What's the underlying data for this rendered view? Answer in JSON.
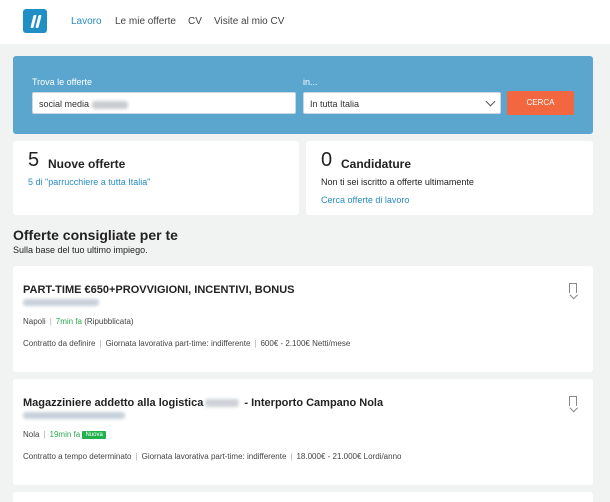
{
  "nav": {
    "items": [
      "Lavoro",
      "Le mie offerte",
      "CV",
      "Visite al mio CV"
    ]
  },
  "search": {
    "what_label": "Trova le offerte",
    "what_value": "social media",
    "where_label": "in...",
    "where_value": "In tutta Italia",
    "button": "CERCA"
  },
  "stats": {
    "new_offers": {
      "count": "5",
      "title": "Nuove offerte",
      "link": "5 di \"parrucchiere a tutta Italia\""
    },
    "applications": {
      "count": "0",
      "title": "Candidature",
      "text": "Non ti sei iscritto a offerte ultimamente",
      "link": "Cerca offerte di lavoro"
    }
  },
  "recommended": {
    "title": "Offerte consigliate per te",
    "subtitle": "Sulla base del tuo ultimo impiego."
  },
  "jobs": [
    {
      "title": "PART-TIME €650+PROVVIGIONI, INCENTIVI, BONUS",
      "city": "Napoli",
      "time": "7min fa",
      "status": "(Ripubblicata)",
      "contract": "Contratto da definire",
      "workday": "Giornata lavorativa part-time: indifferente",
      "salary": "600€ - 2.100€ Netti/mese"
    },
    {
      "title_start": "Magazziniere addetto alla logistica",
      "title_end": " - Interporto Campano Nola",
      "city": "Nola",
      "time": "19min fa",
      "badge": "Nuova",
      "contract": "Contratto a tempo determinato",
      "workday": "Giornata lavorativa part-time: indifferente",
      "salary": "18.000€ - 21.000€ Lordi/anno"
    }
  ],
  "colors": {
    "brand": "#1f8fc5",
    "search_bg": "#5ba6ce",
    "button": "#f2673f",
    "link": "#2a8cc1",
    "new_badge": "#20b04c"
  }
}
